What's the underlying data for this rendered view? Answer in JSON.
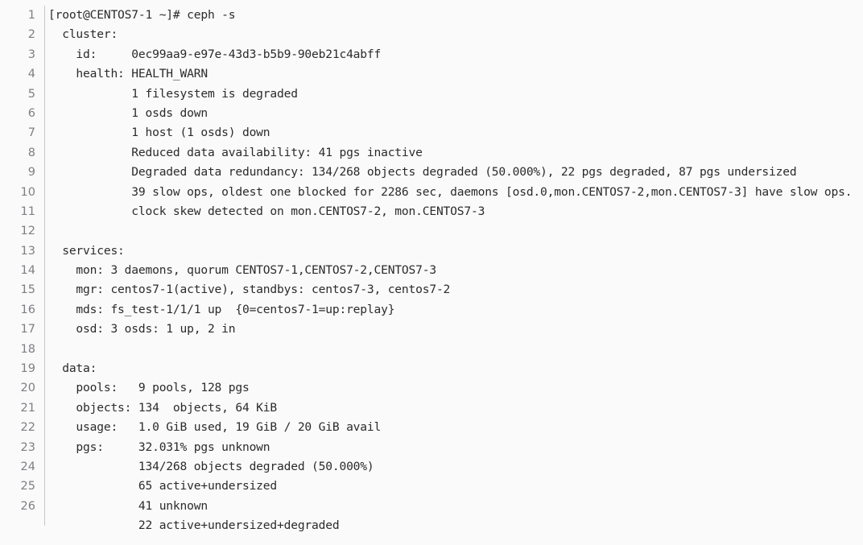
{
  "terminal": {
    "prompt": "[root@CENTOS7-1 ~]# ceph -s",
    "gutter_divider_color": "#c9c9c9",
    "background_color": "#fafafa",
    "text_color": "#2b2b2b",
    "line_number_color": "#7d7f85"
  },
  "lines": [
    {
      "number": "1",
      "text": "[root@CENTOS7-1 ~]# ceph -s"
    },
    {
      "number": "2",
      "text": "  cluster:"
    },
    {
      "number": "3",
      "text": "    id:     0ec99aa9-e97e-43d3-b5b9-90eb21c4abff"
    },
    {
      "number": "4",
      "text": "    health: HEALTH_WARN"
    },
    {
      "number": "5",
      "text": "            1 filesystem is degraded"
    },
    {
      "number": "6",
      "text": "            1 osds down"
    },
    {
      "number": "7",
      "text": "            1 host (1 osds) down"
    },
    {
      "number": "8",
      "text": "            Reduced data availability: 41 pgs inactive"
    },
    {
      "number": "9",
      "text": "            Degraded data redundancy: 134/268 objects degraded (50.000%), 22 pgs degraded, 87 pgs undersized"
    },
    {
      "number": "10",
      "text": "            39 slow ops, oldest one blocked for 2286 sec, daemons [osd.0,mon.CENTOS7-2,mon.CENTOS7-3] have slow ops."
    },
    {
      "number": "11",
      "text": "            clock skew detected on mon.CENTOS7-2, mon.CENTOS7-3"
    },
    {
      "number": "12",
      "text": ""
    },
    {
      "number": "13",
      "text": "  services:"
    },
    {
      "number": "14",
      "text": "    mon: 3 daemons, quorum CENTOS7-1,CENTOS7-2,CENTOS7-3"
    },
    {
      "number": "15",
      "text": "    mgr: centos7-1(active), standbys: centos7-3, centos7-2"
    },
    {
      "number": "16",
      "text": "    mds: fs_test-1/1/1 up  {0=centos7-1=up:replay}"
    },
    {
      "number": "17",
      "text": "    osd: 3 osds: 1 up, 2 in"
    },
    {
      "number": "18",
      "text": ""
    },
    {
      "number": "19",
      "text": "  data:"
    },
    {
      "number": "20",
      "text": "    pools:   9 pools, 128 pgs"
    },
    {
      "number": "21",
      "text": "    objects: 134  objects, 64 KiB"
    },
    {
      "number": "22",
      "text": "    usage:   1.0 GiB used, 19 GiB / 20 GiB avail"
    },
    {
      "number": "23",
      "text": "    pgs:     32.031% pgs unknown"
    },
    {
      "number": "24",
      "text": "             134/268 objects degraded (50.000%)"
    },
    {
      "number": "25",
      "text": "             65 active+undersized"
    },
    {
      "number": "26",
      "text": "             41 unknown"
    },
    {
      "number": "",
      "text": "             22 active+undersized+degraded"
    }
  ]
}
